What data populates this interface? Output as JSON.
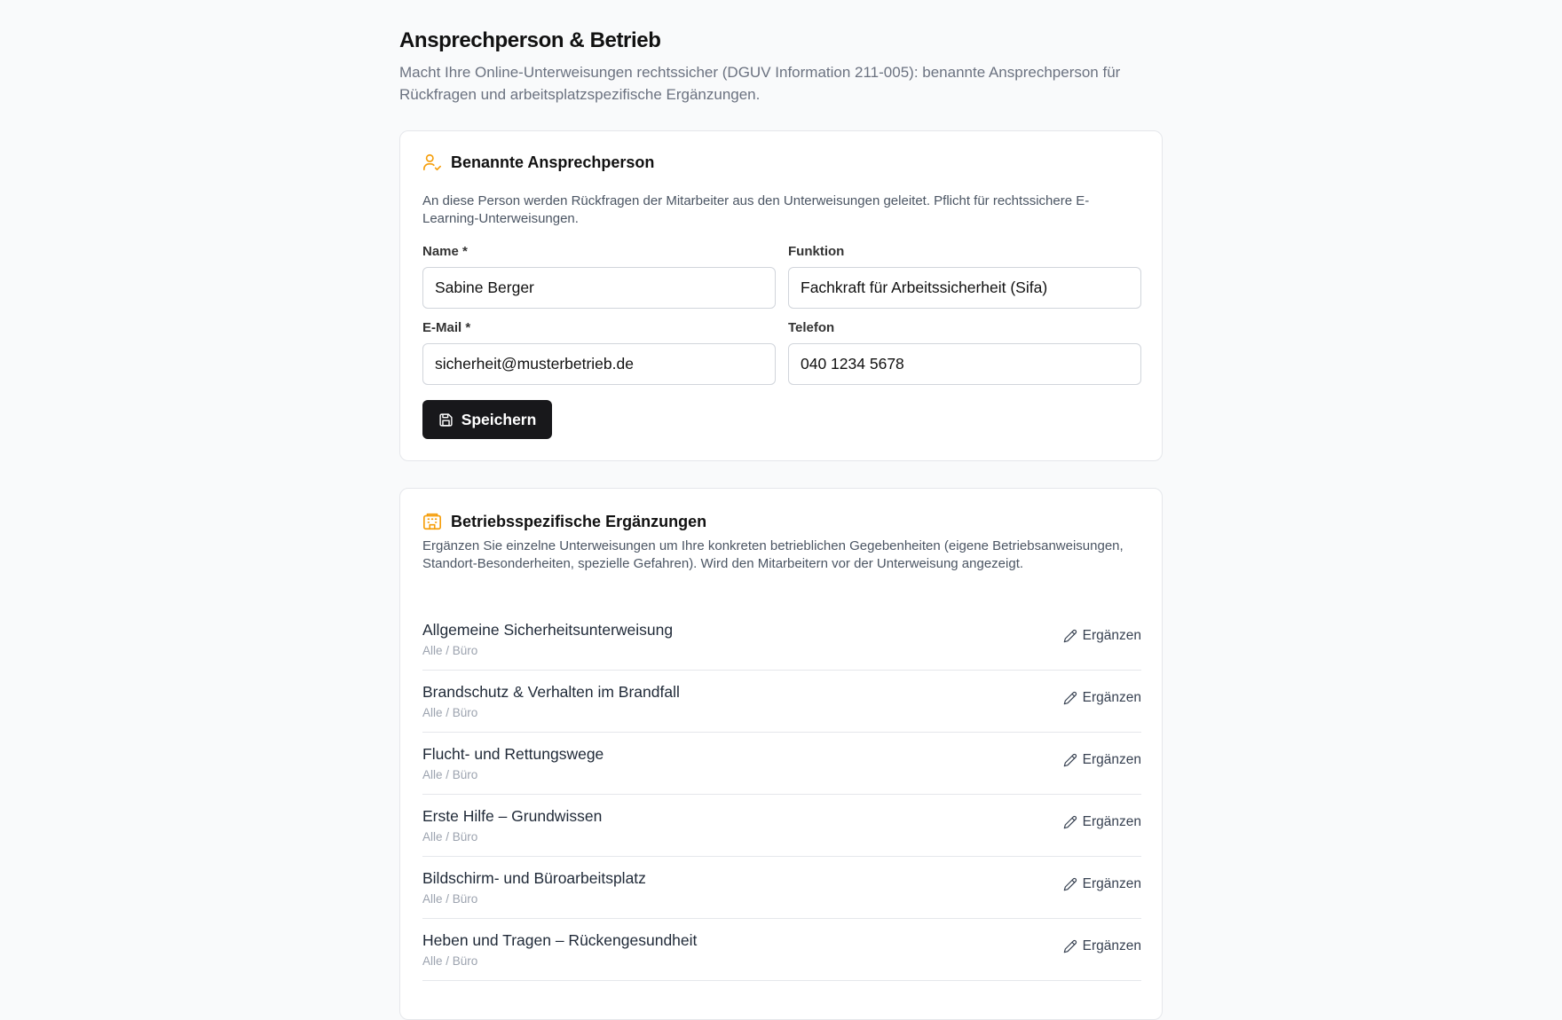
{
  "header": {
    "title": "Ansprechperson & Betrieb",
    "subtitle": "Macht Ihre Online-Unterweisungen rechtssicher (DGUV Information 211-005): benannte Ansprechperson für Rückfragen und arbeitsplatzspezifische Ergänzungen."
  },
  "contact_card": {
    "icon": "user-check-icon",
    "title": "Benannte Ansprechperson",
    "description": "An diese Person werden Rückfragen der Mitarbeiter aus den Unterweisungen geleitet. Pflicht für rechtssichere E-Learning-Unterweisungen.",
    "fields": {
      "name": {
        "label": "Name *",
        "value": "Sabine Berger"
      },
      "function": {
        "label": "Funktion",
        "value": "Fachkraft für Arbeitssicherheit (Sifa)"
      },
      "email": {
        "label": "E-Mail *",
        "value": "sicherheit@musterbetrieb.de"
      },
      "phone": {
        "label": "Telefon",
        "value": "040 1234 5678"
      }
    },
    "save_label": "Speichern",
    "save_icon": "save-icon"
  },
  "supplements_card": {
    "icon": "building-icon",
    "title": "Betriebsspezifische Ergänzungen",
    "description": "Ergänzen Sie einzelne Unterweisungen um Ihre konkreten betrieblichen Gegebenheiten (eigene Betriebsanweisungen, Standort-Besonderheiten, spezielle Gefahren). Wird den Mitarbeitern vor der Unterweisung angezeigt.",
    "action_label": "Ergänzen",
    "action_icon": "pencil-icon",
    "items": [
      {
        "title": "Allgemeine Sicherheitsunterweisung",
        "meta": "Alle / Büro"
      },
      {
        "title": "Brandschutz & Verhalten im Brandfall",
        "meta": "Alle / Büro"
      },
      {
        "title": "Flucht- und Rettungswege",
        "meta": "Alle / Büro"
      },
      {
        "title": "Erste Hilfe – Grundwissen",
        "meta": "Alle / Büro"
      },
      {
        "title": "Bildschirm- und Büroarbeitsplatz",
        "meta": "Alle / Büro"
      },
      {
        "title": "Heben und Tragen – Rückengesundheit",
        "meta": "Alle / Büro"
      }
    ]
  },
  "colors": {
    "accent": "#f59e0b",
    "button_bg": "#18181b",
    "background": "#f9fafb"
  }
}
